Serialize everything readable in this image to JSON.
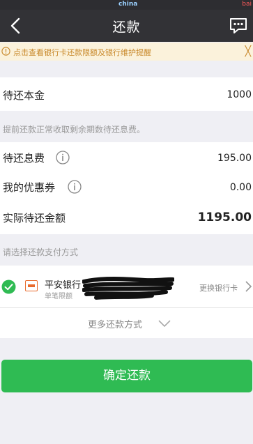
{
  "status_bar": {
    "left_text": "",
    "brand": "china",
    "right_text": "bai"
  },
  "nav": {
    "title": "还款",
    "back_icon": "chevron-left-icon",
    "menu_icon": "chat-dots-icon"
  },
  "notice": {
    "text": "点击查看银行卡还款限额及银行维护提醒",
    "close": "╳"
  },
  "principal": {
    "label": "待还本金",
    "value": "1000"
  },
  "fee_tip": "提前还款正常收取剩余期数待还息费。",
  "interest": {
    "label": "待还息费",
    "value": "195.00"
  },
  "coupon": {
    "label": "我的优惠券",
    "value": "0.00"
  },
  "total": {
    "label": "实际待还金额",
    "value": "1195.00"
  },
  "payment": {
    "section_tip": "请选择还款支付方式",
    "bank_name": "平安银行",
    "bank_sub": "单笔限额",
    "change_label": "更换银行卡",
    "more_label": "更多还款方式"
  },
  "confirm_label": "确定还款",
  "colors": {
    "primary": "#2fbb53",
    "navbar": "#323236",
    "notice_bg": "#fbf2db",
    "notice_text": "#c8882a"
  }
}
